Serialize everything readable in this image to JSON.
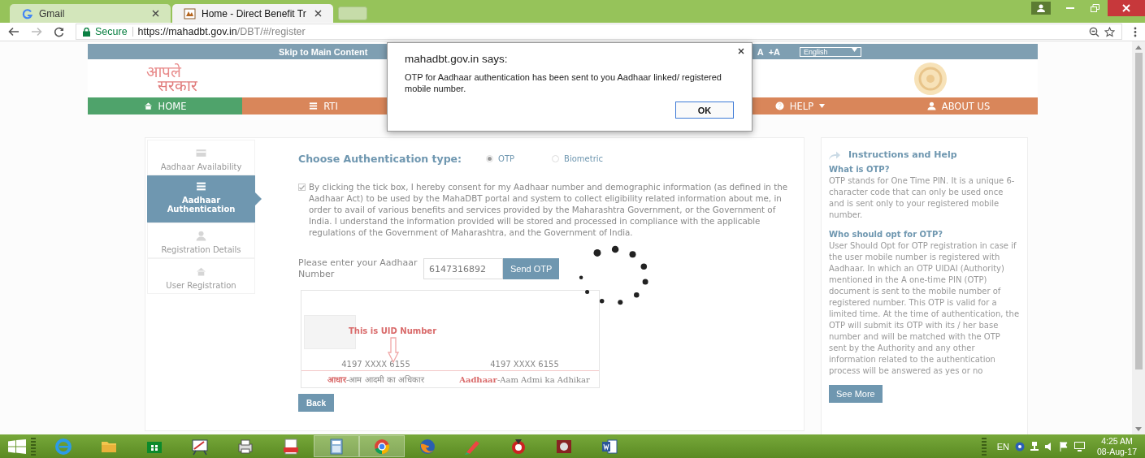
{
  "browser": {
    "tabs": [
      {
        "title": "Gmail",
        "kind": "google",
        "selected": false
      },
      {
        "title": "Home - Direct Benefit Tr",
        "kind": "site",
        "selected": true
      }
    ],
    "secure_label": "Secure",
    "url_host": "https://mahadbt.gov.in",
    "url_path": "/DBT/#/register"
  },
  "site": {
    "skip_link": "Skip to Main Content",
    "font_controls": [
      "A",
      "+A"
    ],
    "language": "English",
    "logo_lines": [
      "आपले",
      "सरकार"
    ],
    "nav": [
      {
        "label": "HOME",
        "kind": "home",
        "dropdown": false,
        "selected": true
      },
      {
        "label": "RTI",
        "kind": "list",
        "dropdown": false,
        "selected": false
      },
      {
        "label": "HELP",
        "kind": "help",
        "dropdown": true,
        "selected": false
      },
      {
        "label": "ABOUT US",
        "kind": "user",
        "dropdown": false,
        "selected": false
      }
    ]
  },
  "steps": [
    {
      "label": "Aadhaar Availability",
      "kind": "card",
      "selected": false
    },
    {
      "label": "Aadhaar Authentication",
      "kind": "list",
      "selected": true
    },
    {
      "label": "Registration Details",
      "kind": "user",
      "selected": false
    },
    {
      "label": "User Registration",
      "kind": "home",
      "selected": false
    }
  ],
  "form": {
    "auth_title": "Choose Authentication type:",
    "auth_options": [
      {
        "label": "OTP",
        "selected": true
      },
      {
        "label": "Biometric",
        "selected": false
      }
    ],
    "consent": {
      "checked": true,
      "text": "By clicking the tick box, I hereby consent for my Aadhaar number and demographic information (as defined in the Aadhaar Act) to be used by the MahaDBT portal and system to collect eligibility related information about me, in order to avail of various benefits and services provided by the Maharashtra Government, or the Government of India. I understand the information provided will be stored and processed in compliance with the applicable regulations of the Government of Maharashtra, and the Government of India."
    },
    "aadhaar_label": "Please enter your Aadhaar Number",
    "aadhaar_value": "6147316892",
    "send_button": "Send OTP",
    "sample": {
      "caption": "This is UID Number",
      "numbers": [
        "4197 XXXX 6155",
        "4197 XXXX 6155"
      ],
      "footers": [
        {
          "highlight": "आधार",
          "rest": "-आम आदमी का अधिकार"
        },
        {
          "highlight": "Aadhaar",
          "rest": "-Aam Admi ka Adhikar"
        }
      ]
    },
    "back_button": "Back"
  },
  "help": {
    "title": "Instructions and Help",
    "sections": [
      {
        "heading": "What is OTP?",
        "body": "OTP stands for One Time PIN. It is a unique 6-character code that can only be used once and is sent only to your registered mobile number."
      },
      {
        "heading": "Who should opt for OTP?",
        "body": "User Should Opt for OTP registration in case if the user mobile number is registered with Aadhaar. In which an OTP UIDAI (Authority) mentioned in the A one-time PIN (OTP) document is sent to the mobile number of registered number. This OTP is valid for a limited time. At the time of authentication, the OTP will submit its OTP with its / her base number and will be matched with the OTP sent by the Authority and any other information related to the authentication process will be answered as yes or no"
      }
    ],
    "see_more": "See More"
  },
  "dialog": {
    "title": "mahadbt.gov.in says:",
    "message": "OTP for Aadhaar authentication has been sent to you Aadhaar linked/ registered mobile number.",
    "ok": "OK"
  },
  "taskbar": {
    "apps": [
      {
        "kind": "ie",
        "running": false
      },
      {
        "kind": "folder",
        "running": false
      },
      {
        "kind": "store",
        "running": false
      },
      {
        "kind": "paint",
        "running": false
      },
      {
        "kind": "scanner",
        "running": false
      },
      {
        "kind": "pdf",
        "running": false
      },
      {
        "kind": "calculator",
        "running": true
      },
      {
        "kind": "chrome",
        "running": true
      },
      {
        "kind": "firefox",
        "running": false
      },
      {
        "kind": "ccleaner",
        "running": false
      },
      {
        "kind": "media",
        "running": false
      },
      {
        "kind": "game",
        "running": false
      },
      {
        "kind": "word",
        "running": false
      }
    ],
    "language": "EN",
    "time": "4:25 AM",
    "date": "08-Aug-17"
  }
}
